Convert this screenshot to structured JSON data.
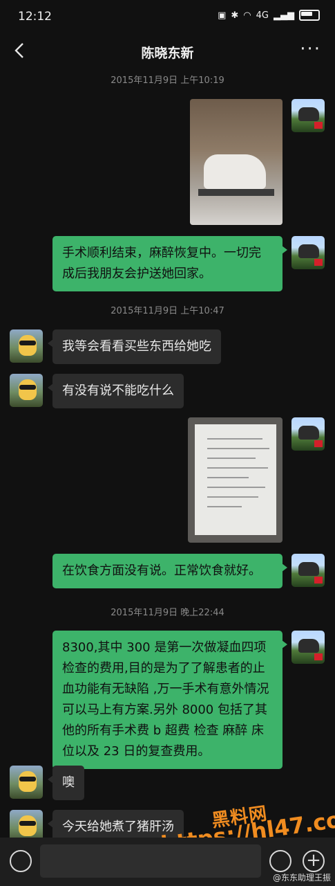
{
  "status_bar": {
    "time": "12:12",
    "network": "4G"
  },
  "header": {
    "title": "陈晓东新",
    "more": "···"
  },
  "timestamps": [
    "2015年11月9日 上午10:19",
    "2015年11月9日 上午10:47",
    "2015年11月9日 晚上22:44"
  ],
  "messages": [
    {
      "from": "me",
      "type": "image",
      "content": "hospital-bed-photo"
    },
    {
      "from": "me",
      "type": "text",
      "text": "手术顺利结束，麻醉恢复中。一切完成后我朋友会护送她回家。"
    },
    {
      "from": "other",
      "type": "text",
      "text": "我等会看看买些东西给她吃"
    },
    {
      "from": "other",
      "type": "text",
      "text": "有没有说不能吃什么"
    },
    {
      "from": "me",
      "type": "image",
      "content": "document-photo"
    },
    {
      "from": "me",
      "type": "text",
      "text": "在饮食方面没有说。正常饮食就好。"
    },
    {
      "from": "me",
      "type": "text",
      "text": "8300,其中 300 是第一次做凝血四项检查的费用,目的是为了了解患者的止血功能有无缺陷 ,万一手术有意外情况可以马上有方案.另外 8000 包括了其他的所有手术费  b 超费  检查  麻醉  床位以及 23 日的复查费用。"
    },
    {
      "from": "other",
      "type": "text",
      "text": "噢"
    },
    {
      "from": "other",
      "type": "text",
      "text": "今天给她煮了猪肝汤"
    }
  ],
  "watermarks": {
    "site": "黑料网",
    "url": "https://hl47.co",
    "weibo": "@东东助理王振"
  },
  "colors": {
    "bubble_me": "#3db36a",
    "bubble_other": "#2c2c2c",
    "background": "#111111"
  }
}
